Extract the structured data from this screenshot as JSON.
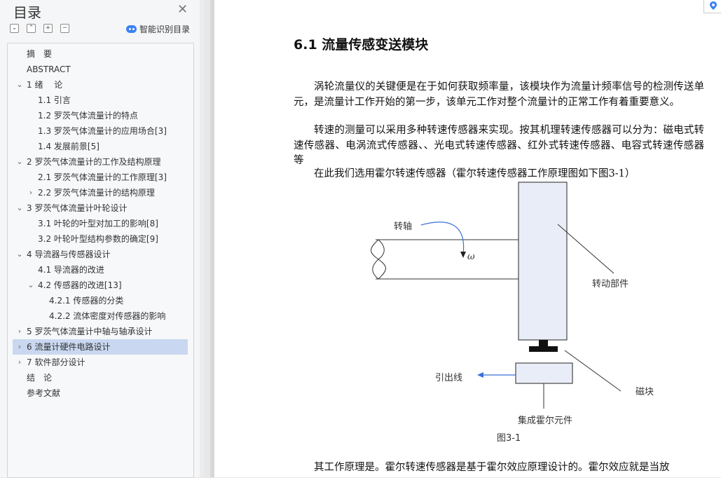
{
  "sidebar": {
    "title": "目录",
    "smart_toc_label": "智能识别目录",
    "toolbar_glyphs": {
      "collapse": "⌄",
      "expand": "⌃",
      "add": "+",
      "remove": "−"
    },
    "items": [
      {
        "label": "摘　要",
        "indent": 0,
        "expander": "none"
      },
      {
        "label": "ABSTRACT",
        "indent": 0,
        "expander": "none"
      },
      {
        "label": "1 绪　 论",
        "indent": 0,
        "expander": "expanded"
      },
      {
        "label": "1.1  引言",
        "indent": 1,
        "expander": "none"
      },
      {
        "label": "1.2  罗茨气体流量计的特点",
        "indent": 1,
        "expander": "none"
      },
      {
        "label": "1.3 罗茨气体流量计的应用场合[3]",
        "indent": 1,
        "expander": "none"
      },
      {
        "label": "1.4  发展前景[5]",
        "indent": 1,
        "expander": "none"
      },
      {
        "label": "2 罗茨气体流量计的工作及结构原理",
        "indent": 0,
        "expander": "expanded"
      },
      {
        "label": "2.1  罗茨气体流量计的工作原理[3]",
        "indent": 1,
        "expander": "none"
      },
      {
        "label": "2.2 罗茨气体流量计的结构原理",
        "indent": 1,
        "expander": "collapsed"
      },
      {
        "label": "3 罗茨气体流量计叶轮设计",
        "indent": 0,
        "expander": "expanded"
      },
      {
        "label": "3.1 叶轮的叶型对加工的影响[8]",
        "indent": 1,
        "expander": "none"
      },
      {
        "label": "3.2 叶轮叶型结构参数的确定[9]",
        "indent": 1,
        "expander": "none"
      },
      {
        "label": "4  导流器与传感器设计",
        "indent": 0,
        "expander": "expanded"
      },
      {
        "label": "4.1 导流器的改进",
        "indent": 1,
        "expander": "none"
      },
      {
        "label": "4.2 传感器的改进[13]",
        "indent": 1,
        "expander": "expanded"
      },
      {
        "label": "4.2.1  传感器的分类",
        "indent": 2,
        "expander": "none"
      },
      {
        "label": "4.2.2 流体密度对传感器的影响",
        "indent": 2,
        "expander": "none"
      },
      {
        "label": "5  罗茨气体流量计中轴与轴承设计",
        "indent": 0,
        "expander": "collapsed"
      },
      {
        "label": "6 流量计硬件电路设计",
        "indent": 0,
        "expander": "collapsed",
        "selected": true
      },
      {
        "label": "7  软件部分设计",
        "indent": 0,
        "expander": "collapsed"
      },
      {
        "label": "结　论",
        "indent": 0,
        "expander": "none"
      },
      {
        "label": "参考文献",
        "indent": 0,
        "expander": "none"
      }
    ]
  },
  "document": {
    "heading": "6.1 流量传感变送模块",
    "paragraphs": [
      "涡轮流量仪的关键便是在于如何获取频率量，该模块作为流量计频率信号的检测传送单元，是流量计工作开始的第一步，该单元工作对整个流量计的正常工作有着重要意义。",
      "转速的测量可以采用多种转速传感器来实现。按其机理转速传感器可以分为：磁电式转速传感器、电涡流式传感器、、光电式转速传感器、红外式转速传感器、电容式转速传感器等",
      "在此我们选用霍尔转速传感器（霍尔转速传感器工作原理图如下图3-1）"
    ],
    "figure": {
      "labels": {
        "shaft": "转轴",
        "omega": "ω",
        "rotating_part": "转动部件",
        "lead_wire": "引出线",
        "magnet": "磁块",
        "hall_element": "集成霍尔元件"
      },
      "caption": "图3-1"
    },
    "bottom_paragraph": "其工作原理是。霍尔转速传感器是基于霍尔效应原理设计的。霍尔效应就是当放"
  },
  "colors": {
    "accent": "#3b82f6",
    "selected_bg": "#c9d8f0"
  }
}
